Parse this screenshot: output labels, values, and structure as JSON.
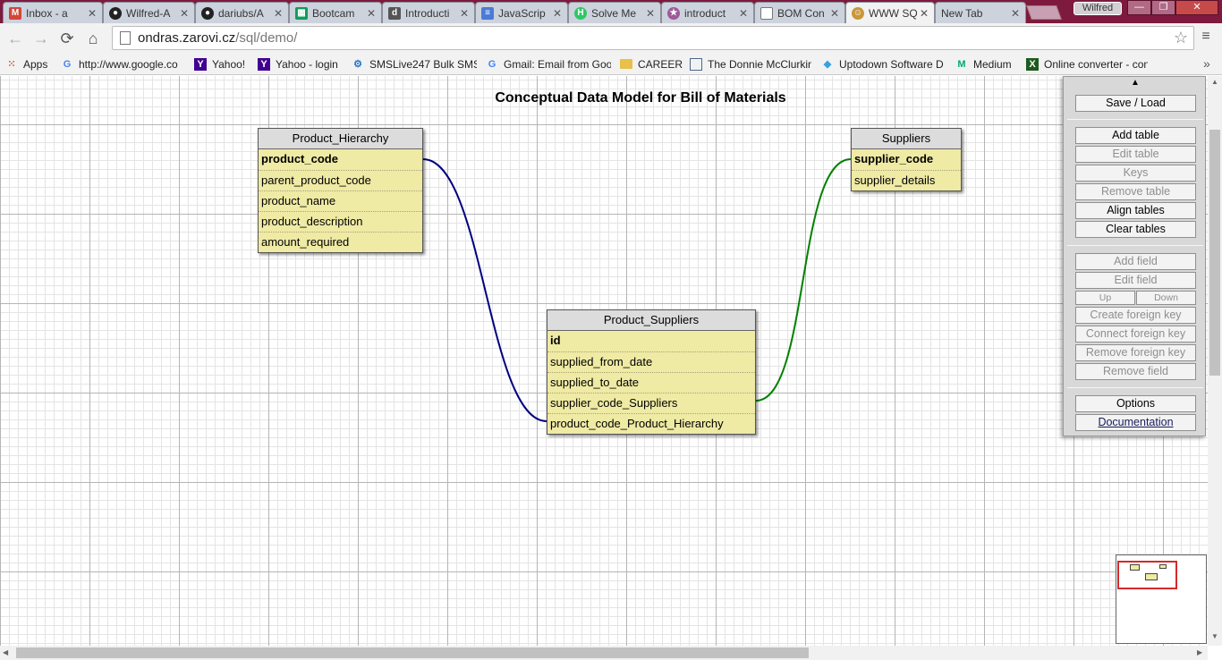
{
  "browser": {
    "tabs": [
      {
        "title": "Inbox - a",
        "icon": "gmail-icon",
        "color": "#d44638"
      },
      {
        "title": "Wilfred-A",
        "icon": "github-icon",
        "color": "#222222"
      },
      {
        "title": "dariubs/A",
        "icon": "github-icon",
        "color": "#222222"
      },
      {
        "title": "Bootcam",
        "icon": "sheets-icon",
        "color": "#0f9d58"
      },
      {
        "title": "Introducti",
        "icon": "doc-icon",
        "color": "#555555"
      },
      {
        "title": "JavaScrip",
        "icon": "docs-icon",
        "color": "#4a7bd6"
      },
      {
        "title": "Solve Me",
        "icon": "hackerrank-icon",
        "color": "#2ec866"
      },
      {
        "title": "introduct",
        "icon": "circle-icon",
        "color": "#9e5a9a"
      },
      {
        "title": "BOM Con",
        "icon": "page-icon",
        "color": "#777777"
      },
      {
        "title": "WWW SQ",
        "icon": "avatar-icon",
        "color": "#c9973a"
      },
      {
        "title": "New Tab",
        "icon": "",
        "color": ""
      }
    ],
    "profile_name": "Wilfred",
    "window_buttons": {
      "minimize": "—",
      "maximize": "❐",
      "close": "✕"
    },
    "nav": {
      "back": "←",
      "forward": "→",
      "reload": "⟳",
      "home": "⌂",
      "star": "☆",
      "menu": "≡"
    },
    "url": {
      "domain": "ondras.zarovi.cz",
      "path": "/sql/demo/"
    },
    "bookmarks": [
      {
        "label": "Apps",
        "icon": "apps-grid-icon",
        "color": "#d44638"
      },
      {
        "label": "http://www.google.co",
        "icon": "google-icon",
        "color": "#4285f4"
      },
      {
        "label": "Yahoo!",
        "icon": "yahoo-icon",
        "color": "#400090"
      },
      {
        "label": "Yahoo - login",
        "icon": "yahoo-icon",
        "color": "#400090"
      },
      {
        "label": "SMSLive247 Bulk SMS",
        "icon": "gear-icon",
        "color": "#2a78c4"
      },
      {
        "label": "Gmail: Email from Goo",
        "icon": "google-icon",
        "color": "#4285f4"
      },
      {
        "label": "CAREER",
        "icon": "folder-icon",
        "color": "#e8c04a"
      },
      {
        "label": "The Donnie McClurkin",
        "icon": "page-icon",
        "color": "#4a6a8a"
      },
      {
        "label": "Uptodown Software D",
        "icon": "diamond-icon",
        "color": "#3aa0e0"
      },
      {
        "label": "Medium",
        "icon": "medium-icon",
        "color": "#00ab6c"
      },
      {
        "label": "Online converter - con",
        "icon": "converter-icon",
        "color": "#2a7a2a"
      }
    ],
    "bookmarks_more": "»"
  },
  "diagram": {
    "title": "Conceptual Data Model for Bill of Materials",
    "tables": [
      {
        "name": "Product_Hierarchy",
        "fields": [
          {
            "name": "product_code",
            "pk": true
          },
          {
            "name": "parent_product_code",
            "pk": false
          },
          {
            "name": "product_name",
            "pk": false
          },
          {
            "name": "product_description",
            "pk": false
          },
          {
            "name": "amount_required",
            "pk": false
          }
        ]
      },
      {
        "name": "Suppliers",
        "fields": [
          {
            "name": "supplier_code",
            "pk": true
          },
          {
            "name": "supplier_details",
            "pk": false
          }
        ]
      },
      {
        "name": "Product_Suppliers",
        "fields": [
          {
            "name": "id",
            "pk": true
          },
          {
            "name": "supplied_from_date",
            "pk": false
          },
          {
            "name": "supplied_to_date",
            "pk": false
          },
          {
            "name": "supplier_code_Suppliers",
            "pk": false
          },
          {
            "name": "product_code_Product_Hierarchy",
            "pk": false
          }
        ]
      }
    ],
    "relations": [
      {
        "from": "Product_Hierarchy.product_code",
        "to": "Product_Suppliers.product_code_Product_Hierarchy",
        "color": "#000080"
      },
      {
        "from": "Suppliers.supplier_code",
        "to": "Product_Suppliers.supplier_code_Suppliers",
        "color": "#008000"
      }
    ]
  },
  "controls": {
    "collapse_arrow": "▲",
    "save_load": "Save / Load",
    "add_table": "Add table",
    "edit_table": "Edit table",
    "keys": "Keys",
    "remove_table": "Remove table",
    "align_tables": "Align tables",
    "clear_tables": "Clear tables",
    "add_field": "Add field",
    "edit_field": "Edit field",
    "up": "Up",
    "down": "Down",
    "create_foreign_key": "Create foreign key",
    "connect_foreign_key": "Connect foreign key",
    "remove_foreign_key": "Remove foreign key",
    "remove_field": "Remove field",
    "options": "Options",
    "documentation": "Documentation"
  },
  "scrollbar_arrows": {
    "up": "▲",
    "down": "▼",
    "left": "◀",
    "right": "▶"
  }
}
